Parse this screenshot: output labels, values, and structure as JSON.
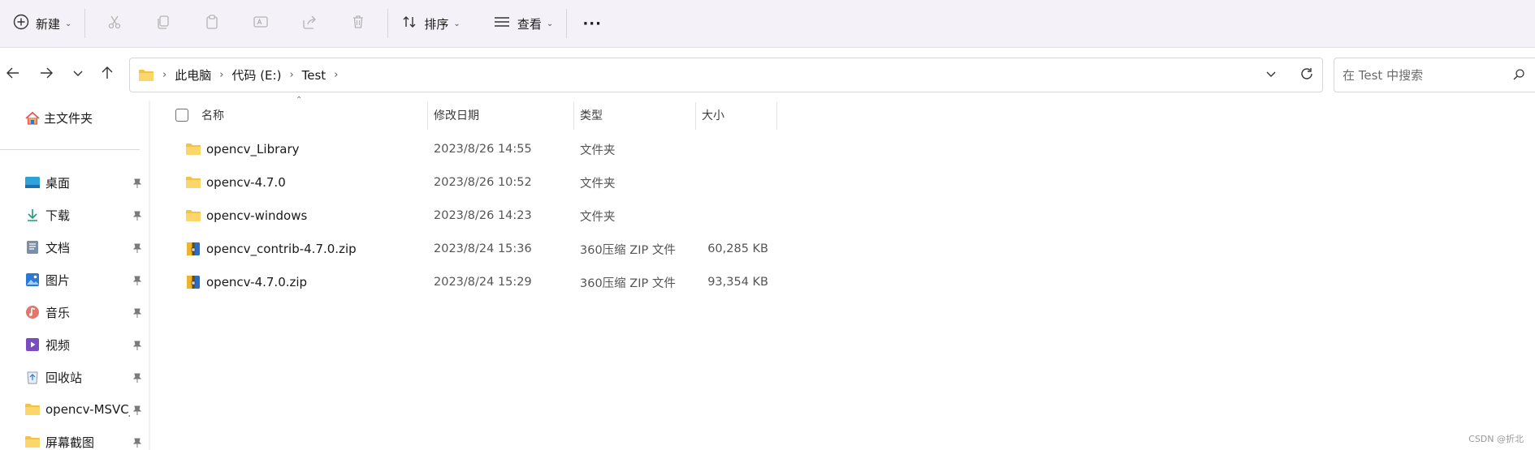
{
  "toolbar": {
    "new_label": "新建",
    "sort_label": "排序",
    "view_label": "查看",
    "more_label": "···"
  },
  "address": {
    "crumbs": [
      "此电脑",
      "代码 (E:)",
      "Test"
    ]
  },
  "search": {
    "placeholder": "在 Test 中搜索"
  },
  "sidebar": {
    "home_label": "主文件夹",
    "items": [
      {
        "label": "桌面",
        "icon": "desktop-icon"
      },
      {
        "label": "下载",
        "icon": "download-icon"
      },
      {
        "label": "文档",
        "icon": "document-icon"
      },
      {
        "label": "图片",
        "icon": "picture-icon"
      },
      {
        "label": "音乐",
        "icon": "music-icon"
      },
      {
        "label": "视频",
        "icon": "video-icon"
      },
      {
        "label": "回收站",
        "icon": "recycle-bin-icon"
      },
      {
        "label": "opencv-MSVC_",
        "icon": "folder-icon"
      },
      {
        "label": "屏幕截图",
        "icon": "folder-icon"
      }
    ]
  },
  "columns": {
    "name": "名称",
    "date": "修改日期",
    "type": "类型",
    "size": "大小"
  },
  "files": [
    {
      "name": "opencv_Library",
      "date": "2023/8/26 14:55",
      "type": "文件夹",
      "size": "",
      "icon": "folder-icon"
    },
    {
      "name": "opencv-4.7.0",
      "date": "2023/8/26 10:52",
      "type": "文件夹",
      "size": "",
      "icon": "folder-icon"
    },
    {
      "name": "opencv-windows",
      "date": "2023/8/26 14:23",
      "type": "文件夹",
      "size": "",
      "icon": "folder-icon"
    },
    {
      "name": "opencv_contrib-4.7.0.zip",
      "date": "2023/8/24 15:36",
      "type": "360压缩 ZIP 文件",
      "size": "60,285 KB",
      "icon": "zip-archive-icon"
    },
    {
      "name": "opencv-4.7.0.zip",
      "date": "2023/8/24 15:29",
      "type": "360压缩 ZIP 文件",
      "size": "93,354 KB",
      "icon": "zip-archive-icon"
    }
  ],
  "watermark": "CSDN @折北",
  "colors": {
    "toolbar_bg": "#f4f2f8",
    "folder_yellow": "#f5c342",
    "accent_blue": "#2b79d6"
  }
}
